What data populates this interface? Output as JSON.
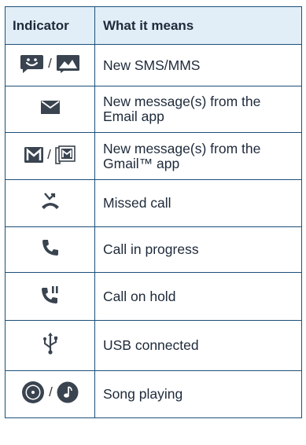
{
  "table": {
    "headers": {
      "indicator": "Indicator",
      "meaning": "What it means"
    },
    "rows": [
      {
        "icon": "sms-smile-icon / mms-picture-icon",
        "separator": "/",
        "meaning": "New SMS/MMS"
      },
      {
        "icon": "envelope-icon",
        "meaning": "New message(s) from the Email app"
      },
      {
        "icon": "gmail-icon / gmail-outline-icon",
        "separator": "/",
        "meaning": "New message(s) from the Gmail™ app"
      },
      {
        "icon": "missed-call-icon",
        "meaning": "Missed call"
      },
      {
        "icon": "phone-handset-icon",
        "meaning": "Call in progress"
      },
      {
        "icon": "call-hold-icon",
        "meaning": "Call on hold"
      },
      {
        "icon": "usb-icon",
        "meaning": "USB connected"
      },
      {
        "icon": "disc-icon / music-note-icon",
        "separator": "/",
        "meaning": "Song playing"
      }
    ]
  },
  "colors": {
    "border": "#1b4f7a",
    "header_bg": "#e2eef7",
    "icon": "#3a4450",
    "text": "#1e2a3a"
  }
}
